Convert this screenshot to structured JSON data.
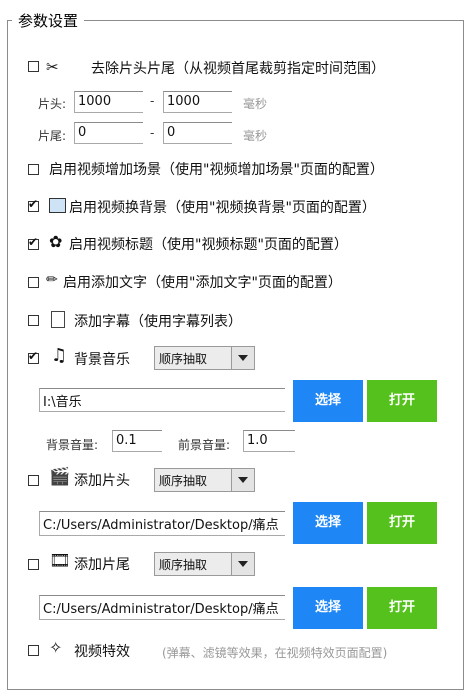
{
  "group": {
    "title": "参数设置"
  },
  "trim": {
    "label": "去除片头片尾（从视频首尾裁剪指定时间范围）",
    "head_label": "片头:",
    "head_from": "1000",
    "head_to": "1000",
    "tail_label": "片尾:",
    "tail_from": "0",
    "tail_to": "0",
    "dash": "-",
    "unit": "毫秒",
    "checked": false,
    "icon": "scissors-icon"
  },
  "scene": {
    "label": "启用视频增加场景（使用\"视频增加场景\"页面的配置）",
    "checked": false
  },
  "background": {
    "label": "启用视频换背景（使用\"视频换背景\"页面的配置）",
    "checked": true,
    "icon": "picture-icon"
  },
  "title": {
    "label": "启用视频标题（使用\"视频标题\"页面的配置）",
    "checked": true,
    "icon": "puzzle-icon"
  },
  "text": {
    "label": "启用添加文字（使用\"添加文字\"页面的配置）",
    "checked": false,
    "icon": "pencil-icon"
  },
  "subtitle": {
    "label": "添加字幕（使用字幕列表）",
    "checked": false,
    "icon": "document-icon"
  },
  "music": {
    "label": "背景音乐",
    "checked": true,
    "icon": "music-note-icon",
    "mode": "顺序抽取",
    "path": "I:\\音乐",
    "select_label": "选择",
    "open_label": "打开",
    "bg_volume_label": "背景音量:",
    "bg_volume": "0.1",
    "fg_volume_label": "前景音量:",
    "fg_volume": "1.0"
  },
  "intro": {
    "label": "添加片头",
    "checked": false,
    "icon": "clapperboard-icon",
    "mode": "顺序抽取",
    "path": "C:/Users/Administrator/Desktop/痛点",
    "select_label": "选择",
    "open_label": "打开"
  },
  "outro": {
    "label": "添加片尾",
    "checked": false,
    "icon": "film-reel-icon",
    "mode": "顺序抽取",
    "path": "C:/Users/Administrator/Desktop/痛点",
    "select_label": "选择",
    "open_label": "打开"
  },
  "effects": {
    "label": "视频特效",
    "hint": "(弹幕、滤镜等效果，在视频特效页面配置)",
    "checked": false,
    "icon": "sparkle-icon"
  },
  "colors": {
    "blue": "#1e86f5",
    "green": "#55c11c"
  }
}
